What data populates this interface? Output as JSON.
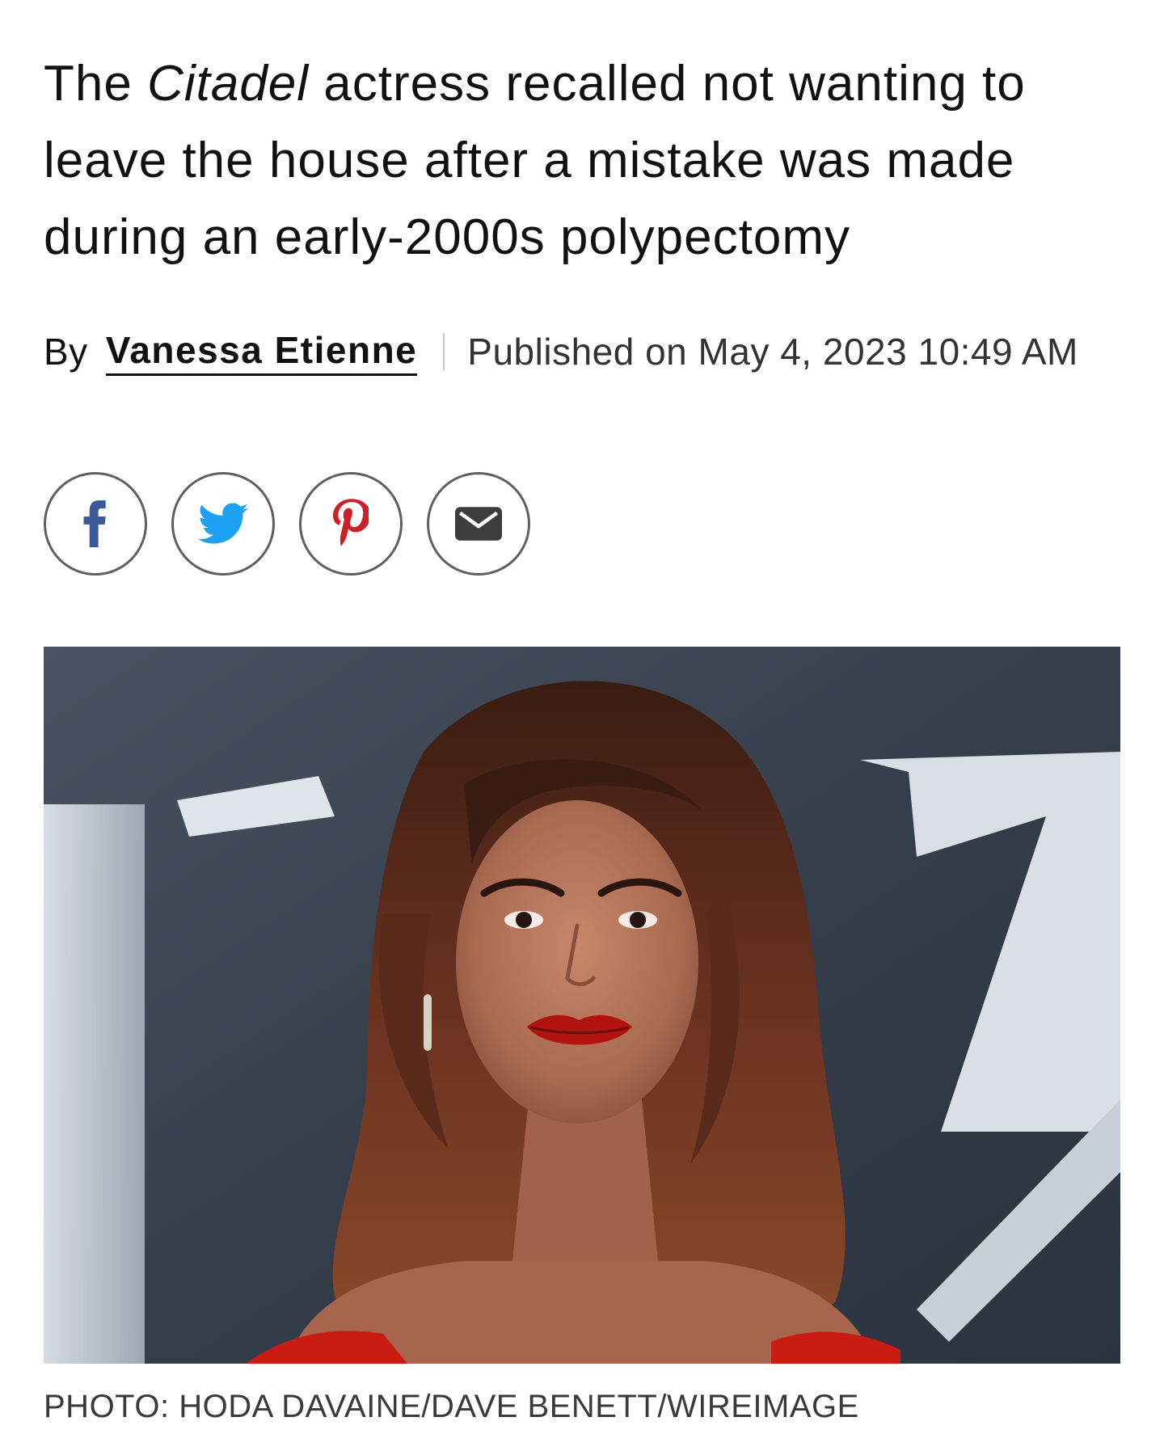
{
  "article": {
    "dek": {
      "part1": "The ",
      "italic": "Citadel",
      "part2": " actress recalled not wanting to leave the house after a mistake was made during an early-2000s polypectomy"
    },
    "byline": {
      "prefix": "By",
      "author": "Vanessa Etienne",
      "published": "Published on May 4, 2023 10:49 AM"
    },
    "share_buttons": [
      {
        "icon": "facebook-icon",
        "color": "#3b5998"
      },
      {
        "icon": "twitter-icon",
        "color": "#1da1f2"
      },
      {
        "icon": "pinterest-icon",
        "color": "#cb2027"
      },
      {
        "icon": "email-icon",
        "color": "#3d3d3d"
      }
    ],
    "photo": {
      "subject": "woman-portrait",
      "lip_color": "#b3130f",
      "dress_color": "#c91d14"
    },
    "photo_credit": "PHOTO: HODA DAVAINE/DAVE BENETT/WIREIMAGE"
  }
}
